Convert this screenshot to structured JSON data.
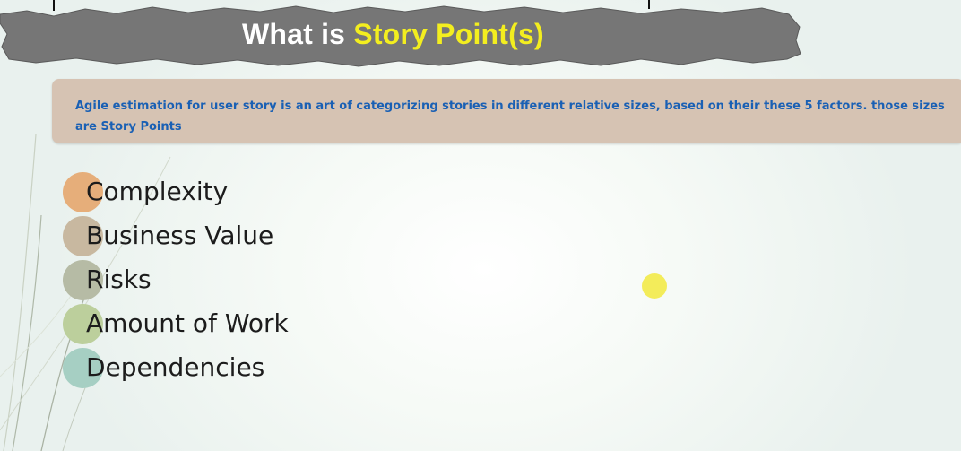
{
  "slide": {
    "title_prefix": "What is ",
    "title_highlight": "Story Point(s)",
    "definition": "Agile estimation for user story is an art of categorizing stories in different relative sizes, based on their these 5 factors. those sizes are  Story Points",
    "factors": [
      {
        "label": "Complexity",
        "bullet_color": "#e6ae7a"
      },
      {
        "label": "Business Value",
        "bullet_color": "#c8b8a0"
      },
      {
        "label": "Risks",
        "bullet_color": "#b6bba5"
      },
      {
        "label": "Amount of Work",
        "bullet_color": "#bccf9c"
      },
      {
        "label": "Dependencies",
        "bullet_color": "#a6cfc3"
      }
    ]
  },
  "colors": {
    "title_highlight": "#f3ee1f",
    "definition_text": "#1a60b4",
    "callout_bg": "#d6c3b3",
    "banner": "#6e6e6e"
  }
}
